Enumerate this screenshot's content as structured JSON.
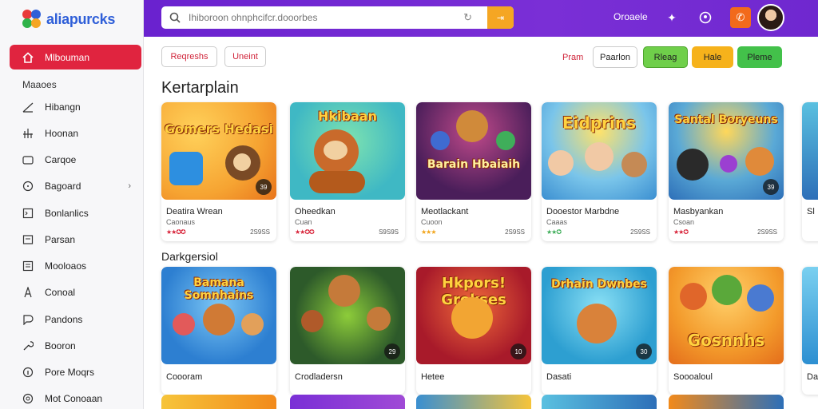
{
  "app": {
    "logo_text": "aliapurcks",
    "brand_color": "#2f5fd8",
    "accent": "#e0243f",
    "topbar_color": "#6a22cf"
  },
  "sidebar": {
    "active_item": {
      "label": "Mlbouman",
      "icon": "home-icon"
    },
    "section_label": "Maaoes",
    "items": [
      {
        "label": "Hibangn",
        "icon": "chart-icon"
      },
      {
        "label": "Hoonan",
        "icon": "bars-icon"
      },
      {
        "label": "Carqoe",
        "icon": "folder-icon"
      },
      {
        "label": "Bagoard",
        "icon": "circle-icon",
        "chevron": "›"
      },
      {
        "label": "Bonlanlics",
        "icon": "square-icon"
      },
      {
        "label": "Parsan",
        "icon": "box-icon"
      },
      {
        "label": "Mooloaos",
        "icon": "list-icon"
      },
      {
        "label": "Conoal",
        "icon": "flag-icon"
      },
      {
        "label": "Pandons",
        "icon": "chat-icon"
      },
      {
        "label": "Booron",
        "icon": "wrench-icon"
      },
      {
        "label": "Pore Moqrs",
        "icon": "info-icon"
      },
      {
        "label": "Mot Conoaan",
        "icon": "globe-icon"
      }
    ]
  },
  "topbar": {
    "search_placeholder": "Ihiboroon ohnphcifcr.dooorbes",
    "search_go": "⇥",
    "link": "Oroaele",
    "icons": [
      "puzzle-icon",
      "refresh-user-icon"
    ],
    "notify_icon": "phone-icon"
  },
  "filters": {
    "left_pills": [
      "Reqreshs",
      "Uneint"
    ],
    "link": "Pram",
    "buttons": [
      {
        "label": "Paarlon",
        "color": "#ffffff"
      },
      {
        "label": "Rleag",
        "color": "#6fcf4a"
      },
      {
        "label": "Hale",
        "color": "#f6b21b"
      },
      {
        "label": "Pleme",
        "color": "#43c14a"
      }
    ]
  },
  "section1": {
    "title": "Kertarplain",
    "cards": [
      {
        "art": "Gomers Hedasi",
        "badge": "39",
        "title": "Deatira Wrean",
        "subtitle": "Caonaus",
        "stars": "★★✪✪",
        "count": "2S9SS",
        "bg": "#f6a432"
      },
      {
        "art": "Hkibaan",
        "badge": "",
        "title": "Oheedkan",
        "subtitle": "Cuan",
        "stars": "★★✪✪",
        "count": "S9S9S",
        "bg": "#3fb8c4"
      },
      {
        "art": "Barain Hbaiaih",
        "badge": "",
        "title": "Meotlackant",
        "subtitle": "Cuoon",
        "stars": "★★★",
        "count": "2S9SS",
        "bg": "#6a2a7a"
      },
      {
        "art": "Eidprins",
        "badge": "",
        "title": "Dooestor Marbdne",
        "subtitle": "Caaas",
        "stars": "★★✪",
        "count": "2S9SS",
        "bg": "#4ab0d6"
      },
      {
        "art": "Santal Boryeuns",
        "badge": "39",
        "title": "Masbyankan",
        "subtitle": "Csoan",
        "stars": "★★✪",
        "count": "2S9SS",
        "bg": "#3a8fc9"
      }
    ],
    "peek_title": "Sl"
  },
  "section2": {
    "title": "Darkgersiol",
    "cards": [
      {
        "art": "Bamana Somnhains",
        "badge": "",
        "title": "Coooram",
        "bg": "#2d7fd1"
      },
      {
        "art": "",
        "badge": "29",
        "title": "Crodladersn",
        "bg": "#2d5a2a"
      },
      {
        "art": "Hkpors! Grokses",
        "badge": "10",
        "title": "Hetee",
        "bg": "#c9262a"
      },
      {
        "art": "Drhain Dwnbes",
        "badge": "30",
        "title": "Dasati",
        "bg": "#4cb7e0"
      },
      {
        "art": "Gosnnhs",
        "badge": "",
        "title": "Soooaloul",
        "bg": "#f39a2b"
      }
    ],
    "peek_title": "Da"
  }
}
